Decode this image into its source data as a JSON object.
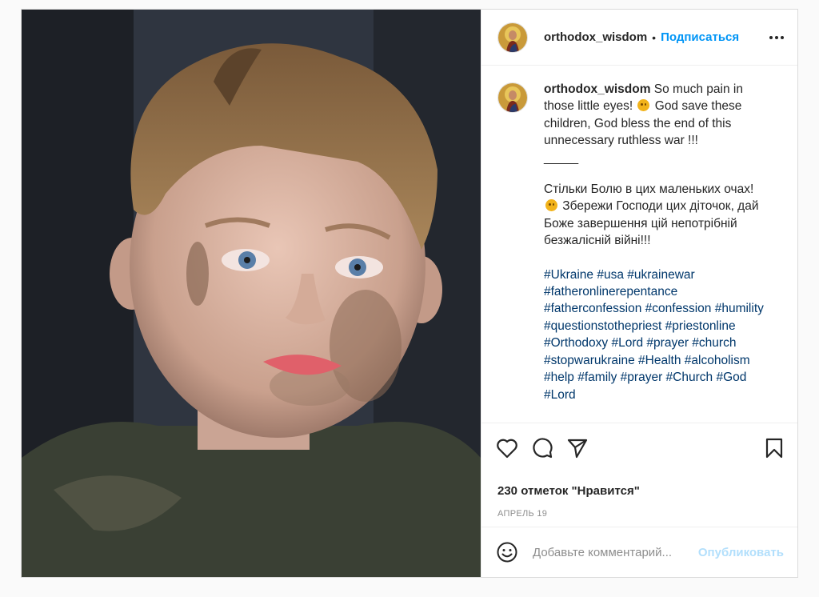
{
  "post": {
    "username": "orthodox_wisdom",
    "dot": "•",
    "follow_label": "Подписаться",
    "avatar_icon": "christ-icon",
    "image_alt": "crying-child-photo"
  },
  "caption": {
    "username": "orthodox_wisdom",
    "text_en_part1": " So much pain in those little eyes! ",
    "text_en_part2": " God save these children, God bless the end of this unnecessary ruthless war !!!",
    "separator": "_____",
    "text_uk_part1": "Стільки Болю в цих маленьких очах!",
    "text_uk_part2": " Збережи Господи цих діточок, дай Боже завершення цій непотрібній безжалісній війні!!!",
    "hashtags": [
      "#Ukraine",
      "#usa",
      "#ukrainewar",
      "#fatheronlinerepentance",
      "#fatherconfession",
      "#confession",
      "#humility",
      "#questionstothepriest",
      "#priestonline",
      "#Orthodoxy",
      "#Lord",
      "#prayer",
      "#church",
      "#stopwarukraine",
      "#Health",
      "#alcoholism",
      "#help",
      "#family",
      "#prayer",
      "#Church",
      "#God",
      "#Lord"
    ]
  },
  "actions": {
    "icons": [
      "heart-icon",
      "comment-icon",
      "share-icon",
      "bookmark-icon"
    ],
    "likes_text": "230 отметок \"Нравится\"",
    "date_text": "АПРЕЛЬ 19"
  },
  "comment": {
    "emoji_icon": "smiley-icon",
    "placeholder": "Добавьте комментарий...",
    "publish_label": "Опубликовать"
  },
  "colors": {
    "link": "#0095f6",
    "publish_disabled": "#b2dffc",
    "hashtag": "#00376b",
    "text": "#262626",
    "muted": "#8e8e8e"
  }
}
